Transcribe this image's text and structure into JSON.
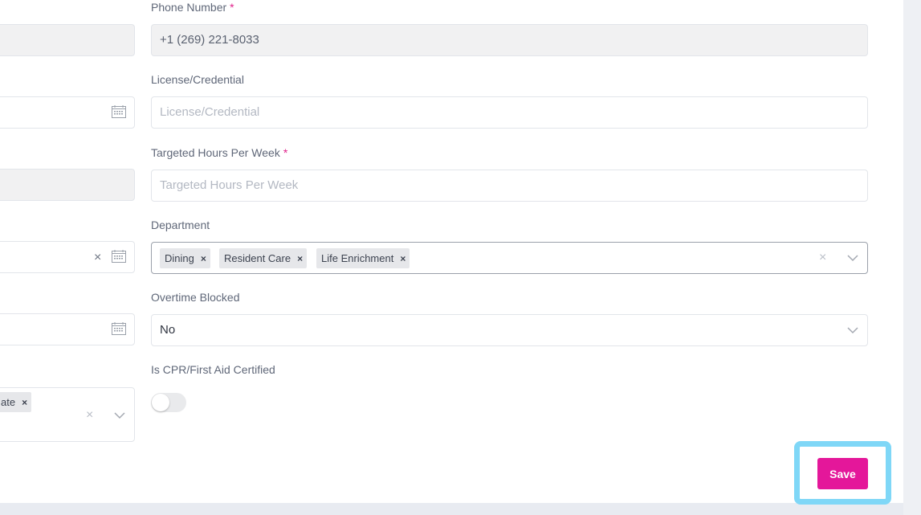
{
  "phone": {
    "label": "Phone Number",
    "required_mark": "*",
    "value": "+1 (269) 221-8033"
  },
  "license": {
    "label": "License/Credential",
    "placeholder": "License/Credential"
  },
  "targeted_hours": {
    "label": "Targeted Hours Per Week",
    "required_mark": "*",
    "placeholder": "Targeted Hours Per Week"
  },
  "department": {
    "label": "Department",
    "tags": [
      "Dining",
      "Resident Care",
      "Life Enrichment"
    ],
    "tag_remove": "×",
    "clear": "×"
  },
  "overtime_blocked": {
    "label": "Overtime Blocked",
    "value": "No"
  },
  "cpr_certified": {
    "label": "Is CPR/First Aid Certified",
    "checked": false
  },
  "left_column": {
    "date_clear": "×",
    "partial_tag": "ate",
    "tag_remove": "×",
    "clear": "×"
  },
  "save_label": "Save",
  "colors": {
    "accent": "#e4179a",
    "highlight": "#7fd7f7"
  }
}
